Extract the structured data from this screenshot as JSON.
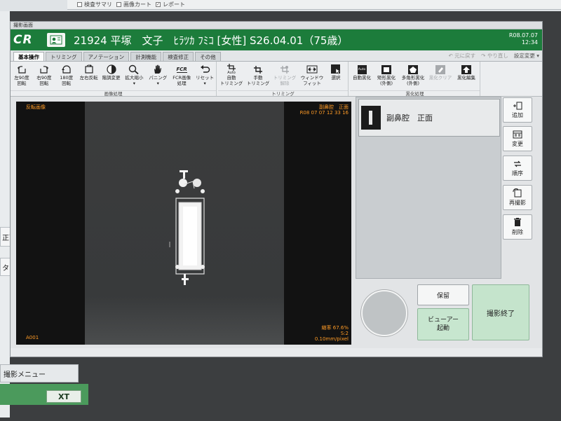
{
  "background_app": {
    "strip_items": [
      {
        "label": "検査サマリ",
        "checked": false
      },
      {
        "label": "画像カート",
        "checked": false
      },
      {
        "label": "レポート",
        "checked": true
      }
    ],
    "fragment_1": "正面",
    "fragment_2": "ターズ",
    "menu_label": "撮影メニュー",
    "green_button_label": "XT"
  },
  "dialog": {
    "title": "撮影画面",
    "logo": "CR",
    "patient_info": "21924 平塚　文子　ﾋﾗﾂｶ ﾌﾐｺ [女性] S26.04.01（75歳）",
    "date": "R08.07.07",
    "time": "12:34"
  },
  "tabs": [
    {
      "label": "基本操作",
      "active": true
    },
    {
      "label": "トリミング",
      "active": false
    },
    {
      "label": "アノテーション",
      "active": false
    },
    {
      "label": "計測機能",
      "active": false
    },
    {
      "label": "検査修正",
      "active": false
    },
    {
      "label": "その他",
      "active": false
    }
  ],
  "tabrow_right": {
    "undo": "元に戻す",
    "redo": "やり直し",
    "settings": "設定変更"
  },
  "toolbar": {
    "image_processing": {
      "group_label": "画像処理",
      "buttons": [
        {
          "line1": "左90度",
          "line2": "回転",
          "icon": "rotate-left-90-icon"
        },
        {
          "line1": "右90度",
          "line2": "回転",
          "icon": "rotate-right-90-icon"
        },
        {
          "line1": "180度",
          "line2": "回転",
          "icon": "rotate-180-icon"
        },
        {
          "line1": "左右反転",
          "line2": "",
          "icon": "flip-horizontal-icon"
        },
        {
          "line1": "階調変更",
          "line2": "",
          "icon": "contrast-icon"
        },
        {
          "line1": "拡大縮小",
          "line2": "▾",
          "icon": "zoom-icon"
        },
        {
          "line1": "パニング",
          "line2": "▾",
          "icon": "hand-pan-icon"
        },
        {
          "line1": "FCR画像",
          "line2": "処理",
          "icon": "fcr-processing-icon",
          "icon_text": "FCR"
        },
        {
          "line1": "リセット",
          "line2": "▾",
          "icon": "reset-icon"
        }
      ]
    },
    "trimming": {
      "group_label": "トリミング",
      "buttons": [
        {
          "line1": "自動",
          "line2": "トリミング",
          "icon": "auto-trim-icon",
          "icon_text": "Auto",
          "disabled": false
        },
        {
          "line1": "手動",
          "line2": "トリミング",
          "icon": "manual-trim-icon",
          "disabled": false
        },
        {
          "line1": "トリミング",
          "line2": "解除",
          "icon": "trim-release-icon",
          "disabled": true
        },
        {
          "line1": "ウィンドウ",
          "line2": "フィット",
          "icon": "window-fit-icon",
          "disabled": false
        },
        {
          "line1": "選択",
          "line2": "",
          "icon": "select-icon",
          "disabled": false
        }
      ]
    },
    "black_fill": {
      "group_label": "黒化処理",
      "buttons": [
        {
          "line1": "自動黒化",
          "line2": "",
          "icon": "auto-black-icon",
          "icon_text": "Auto",
          "disabled": false
        },
        {
          "line1": "矩形黒化",
          "line2": "(外側)",
          "icon": "rect-black-icon",
          "disabled": false
        },
        {
          "line1": "多角形黒化",
          "line2": "(外側)",
          "icon": "polygon-black-icon",
          "disabled": false
        },
        {
          "line1": "黒化クリア",
          "line2": "",
          "icon": "black-clear-icon",
          "disabled": true
        },
        {
          "line1": "黒化編集",
          "line2": "",
          "icon": "black-edit-icon",
          "disabled": false
        }
      ]
    }
  },
  "viewer": {
    "left_label": "反転画像",
    "exam_label": "副鼻腔　正面",
    "exam_datetime": "R08 07 07 12 33 16",
    "bottom_left": "A001",
    "zoom": "縮率 67.6%",
    "sensitivity": "S:2",
    "pixel_size": "0.10mm/pixel"
  },
  "thumbnail": {
    "label": "副鼻腔　正面"
  },
  "side_buttons": [
    {
      "label": "追加",
      "icon": "add-image-icon"
    },
    {
      "label": "変更",
      "icon": "change-icon"
    },
    {
      "label": "順序",
      "icon": "order-icon"
    },
    {
      "label": "再撮影",
      "icon": "reshoot-icon"
    },
    {
      "label": "削除",
      "icon": "trash-icon"
    }
  ],
  "bottom_buttons": {
    "hold": "保留",
    "viewer_line1": "ビューアー",
    "viewer_line2": "起動",
    "end": "撮影終了"
  },
  "colors": {
    "header_green": "#1c7c3b",
    "overlay_orange": "#ff9b26",
    "end_button_green": "#c5e4cc"
  }
}
